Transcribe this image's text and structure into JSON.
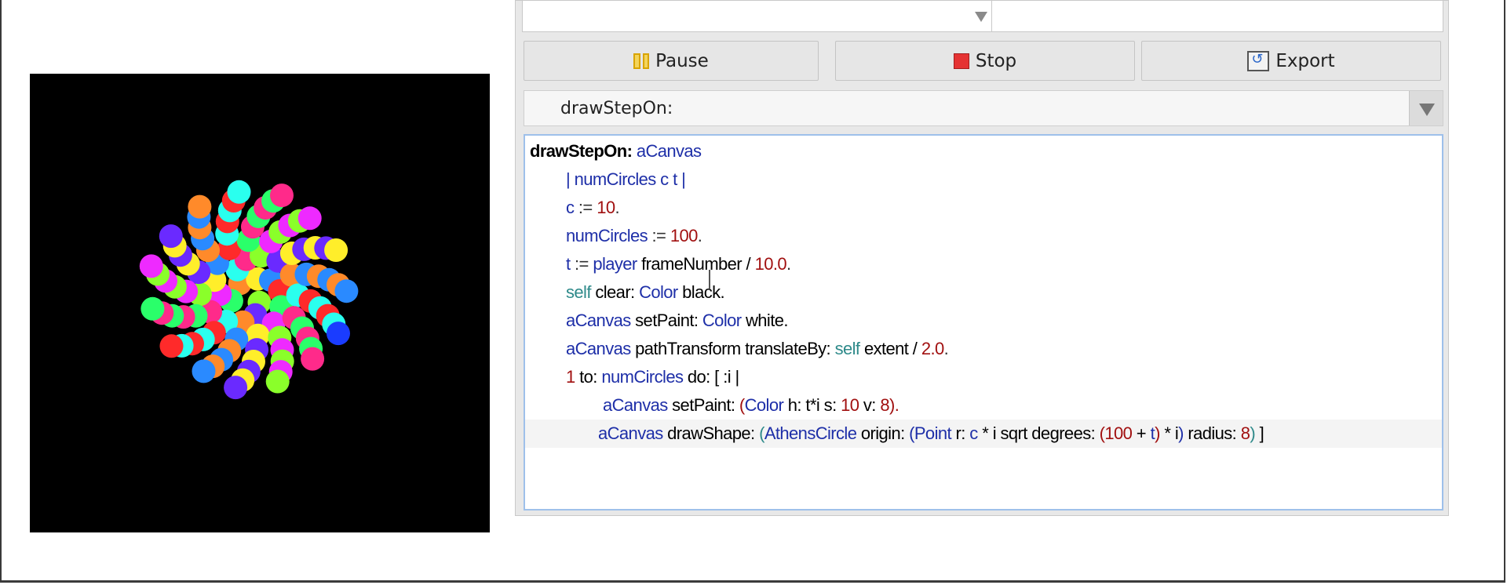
{
  "controls": {
    "pause_label": "Pause",
    "stop_label": "Stop",
    "export_label": "Export",
    "pause_icon": "pause-icon",
    "stop_icon": "stop-icon",
    "export_icon": "export-icon"
  },
  "method_selector": {
    "selected": "drawStepOn:",
    "icon": "chevron-down-icon"
  },
  "canvas": {
    "background": "#000000",
    "palette": [
      "#ff2a2a",
      "#ff8a2a",
      "#ffee2a",
      "#8aff2a",
      "#2aff6a",
      "#2affee",
      "#2a8aff",
      "#6a2aff",
      "#ee2aff",
      "#ff2a8a"
    ]
  },
  "code": {
    "line1": {
      "selector": "drawStepOn:",
      "arg": "aCanvas"
    },
    "line2": {
      "open": "|",
      "temps": "numCircles c t",
      "close": "|"
    },
    "line3": {
      "var": "c",
      "assign": ":=",
      "num": "10",
      "end": "."
    },
    "line4": {
      "var": "numCircles",
      "assign": ":=",
      "num": "100",
      "end": "."
    },
    "line5": {
      "var": "t",
      "assign": ":=",
      "recv": "player",
      "msg": "frameNumber /",
      "num": "10.0",
      "end": "."
    },
    "line6": {
      "self": "self",
      "msg": "clear:",
      "cls": "Color",
      "tail": "black."
    },
    "line7": {
      "recv": "aCanvas",
      "msg": "setPaint:",
      "cls": "Color",
      "tail": "white."
    },
    "line8": {
      "recv": "aCanvas",
      "msg": "pathTransform translateBy:",
      "self": "self",
      "tail": "extent /",
      "num": "2.0",
      "end": "."
    },
    "line9": {
      "num": "1",
      "msg": "to:",
      "var": "numCircles",
      "tail": "do: [ :i |"
    },
    "line10": {
      "recv": "aCanvas",
      "msg": "setPaint:",
      "paren": "(",
      "cls": "Color",
      "m1": "h:",
      "e1": "t*i",
      "m2": "s:",
      "n2": "10",
      "m3": "v:",
      "n3": "8",
      "close": ")."
    },
    "line11": {
      "recv": "aCanvas",
      "msg": "drawShape:",
      "p1": "(",
      "cls": "AthensCircle",
      "m1": "origin:",
      "p2": "(",
      "cls2": "Point",
      "m2": "r:",
      "v1": "c",
      "op": "*",
      "v2": "i",
      "m3": "sqrt degrees:",
      "p3": "(",
      "n1": "100",
      "plus": "+",
      "v3": "t",
      "p4": ")",
      "op2": "*",
      "v4": "i",
      "p5": ")",
      "m4": "radius:",
      "n2": "8",
      "p6": ")",
      "end": "]"
    }
  }
}
